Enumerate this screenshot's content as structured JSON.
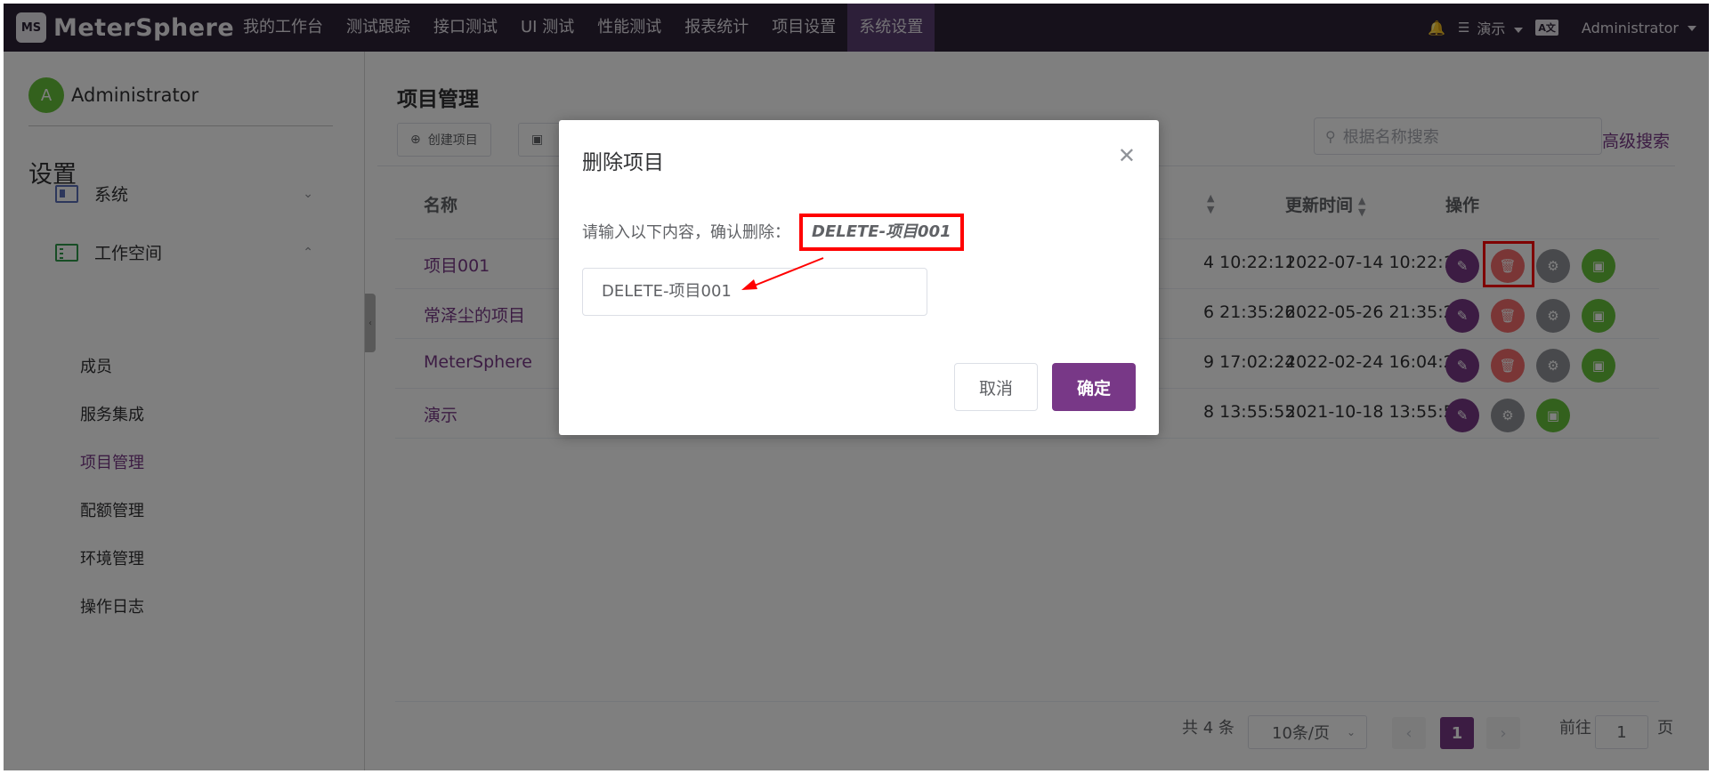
{
  "app": {
    "logo_mark": "MS",
    "logo_text": "MeterSphere"
  },
  "nav": {
    "items": [
      "我的工作台",
      "测试跟踪",
      "接口测试",
      "UI 测试",
      "性能测试",
      "报表统计",
      "项目设置",
      "系统设置"
    ],
    "active": "系统设置"
  },
  "topbar": {
    "workspace": "演示",
    "language_badge": "A文",
    "user": "Administrator"
  },
  "sidebar": {
    "avatar_letter": "A",
    "user": "Administrator",
    "title": "设置",
    "groups": [
      {
        "label": "系统",
        "icon": "id-card-icon",
        "expanded": false
      },
      {
        "label": "工作空间",
        "icon": "list-icon",
        "expanded": true
      }
    ],
    "sub_items": [
      "成员",
      "服务集成",
      "项目管理",
      "配额管理",
      "环境管理",
      "操作日志"
    ],
    "active_sub": "项目管理"
  },
  "main": {
    "title": "项目管理",
    "create_button": "创建项目",
    "search_placeholder": "根据名称搜索",
    "advanced_search": "高级搜索",
    "columns": {
      "name": "名称",
      "update_time": "更新时间",
      "actions": "操作"
    },
    "rows": [
      {
        "name": "项目001",
        "create_time_partial": "4 10:22:11",
        "update_time": "2022-07-14 10:22:11",
        "deletable": true
      },
      {
        "name": "常泽尘的项目",
        "create_time_partial": "6 21:35:26",
        "update_time": "2022-05-26 21:35:26",
        "deletable": true
      },
      {
        "name": "MeterSphere",
        "create_time_partial": "9 17:02:24",
        "update_time": "2022-02-24 16:04:25",
        "deletable": true
      },
      {
        "name": "演示",
        "create_time_partial": "8 13:55:55",
        "update_time": "2021-10-18 13:55:55",
        "deletable": false
      }
    ]
  },
  "pagination": {
    "total": "共 4 条",
    "page_size": "10条/页",
    "current_page": "1",
    "goto_label": "前往",
    "goto_value": "1",
    "page_suffix": "页"
  },
  "dialog": {
    "title": "删除项目",
    "prompt": "请输入以下内容，确认删除：",
    "confirm_code": "DELETE-项目001",
    "input_value": "DELETE-项目001",
    "cancel": "取消",
    "confirm": "确定"
  },
  "colors": {
    "brand": "#783887",
    "topbar": "#2d2237",
    "danger": "#f56c6c",
    "success": "#67c23a",
    "highlight": "#ff0000"
  }
}
